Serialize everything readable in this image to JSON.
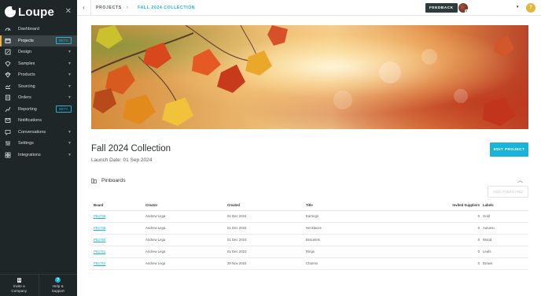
{
  "app": {
    "logo_text": "Loupe"
  },
  "sidebar": {
    "items": [
      {
        "label": "Dashboard",
        "icon": "dashboard-icon"
      },
      {
        "label": "Projects",
        "icon": "projects-icon",
        "badge": "BETA",
        "active": true
      },
      {
        "label": "Design",
        "icon": "design-icon"
      },
      {
        "label": "Samples",
        "icon": "samples-icon"
      },
      {
        "label": "Products",
        "icon": "products-icon"
      },
      {
        "label": "Sourcing",
        "icon": "sourcing-icon"
      },
      {
        "label": "Orders",
        "icon": "orders-icon"
      },
      {
        "label": "Reporting",
        "icon": "reporting-icon",
        "badge": "BETA"
      },
      {
        "label": "Notifications",
        "icon": "notifications-icon"
      },
      {
        "label": "Conversations",
        "icon": "conversations-icon"
      },
      {
        "label": "Settings",
        "icon": "settings-icon"
      },
      {
        "label": "Integrations",
        "icon": "integrations-icon"
      }
    ],
    "footer": {
      "invite_label_1": "Invite a",
      "invite_label_2": "Company",
      "help_label_1": "Help &",
      "help_label_2": "Support"
    }
  },
  "topbar": {
    "breadcrumb_root": "PROJECTS",
    "breadcrumb_current": "FALL 2024 COLLECTION",
    "feedback_label": "FEEDBACK",
    "user_initial": "?"
  },
  "project": {
    "title": "Fall 2024 Collection",
    "launch_date": "Launch Date: 01 Sep 2024",
    "edit_label": "EDIT PROJECT"
  },
  "pinboards": {
    "heading": "Pinboards",
    "add_label": "ADD PINBOARD",
    "columns": [
      "Board",
      "Creator",
      "Created",
      "Title",
      "Invited Suppliers",
      "Labels"
    ],
    "rows": [
      {
        "board": "PB1738",
        "creator": "Andrew Lega",
        "created": "01 Dec 2023",
        "title": "Earrings",
        "invited": "0",
        "label": "Gold"
      },
      {
        "board": "PB1758",
        "creator": "Andrew Lega",
        "created": "01 Dec 2023",
        "title": "Necklaces",
        "invited": "0",
        "label": "Autumn"
      },
      {
        "board": "PB1760",
        "creator": "Andrew Lega",
        "created": "01 Dec 2023",
        "title": "Bracelets",
        "invited": "0",
        "label": "Wood"
      },
      {
        "board": "PB1761",
        "creator": "Andrew Lega",
        "created": "01 Dec 2023",
        "title": "Rings",
        "invited": "0",
        "label": "Leafs"
      },
      {
        "board": "PB1754",
        "creator": "Andrew Lega",
        "created": "29 Nov 2023",
        "title": "Charms",
        "invited": "0",
        "label": "Brown"
      }
    ]
  }
}
